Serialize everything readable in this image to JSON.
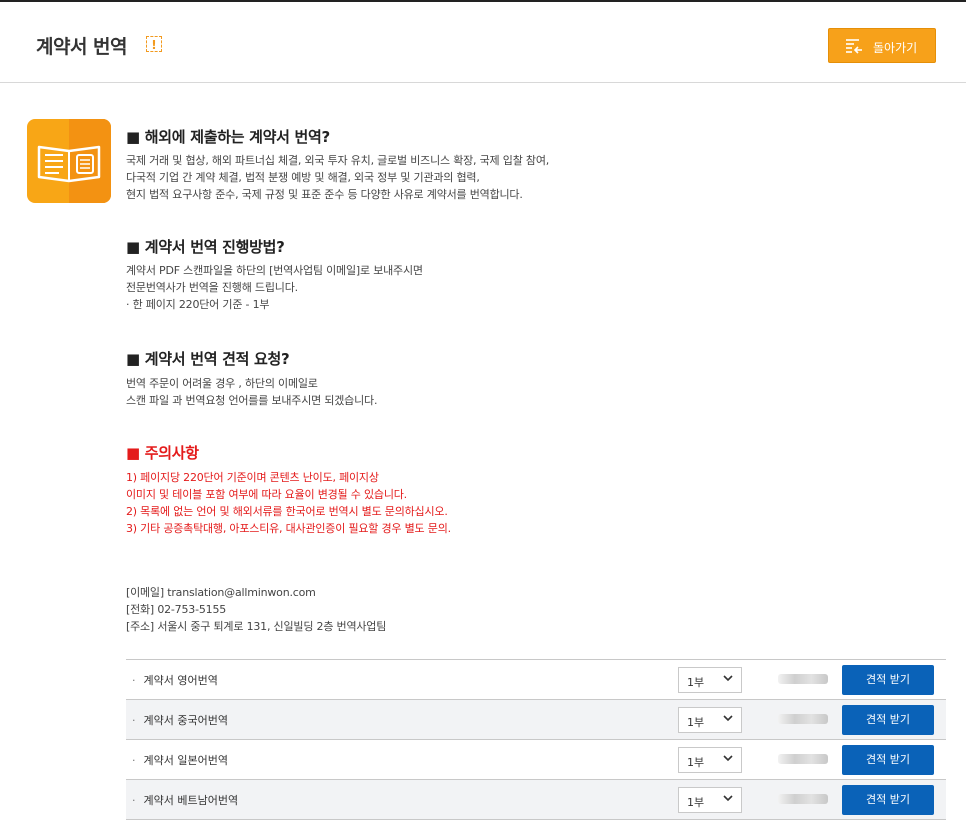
{
  "header": {
    "title": "계약서 번역",
    "info_badge": "!",
    "back_label": "돌아가기"
  },
  "sections": [
    {
      "title": "■ 해외에 제출하는 계약서 번역?",
      "lines": [
        "국제 거래 및 협상, 해외 파트너십 체결, 외국 투자 유치, 글로벌 비즈니스 확장, 국제 입찰 참여,",
        "다국적 기업 간 계약 체결, 법적 분쟁 예방 및 해결, 외국 정부 및 기관과의 협력,",
        "현지 법적 요구사항 준수, 국제 규정 및 표준 준수 등 다양한 사유로 계약서를 번역합니다."
      ]
    },
    {
      "title": "■ 계약서 번역 진행방법?",
      "lines": [
        "계약서 PDF 스캔파일을 하단의 [번역사업팀 이메일]로 보내주시면",
        "전문번역사가 번역을 진행해 드립니다.",
        "· 한 페이지 220단어 기준 - 1부"
      ]
    },
    {
      "title": "■ 계약서 번역 견적 요청?",
      "lines": [
        "번역 주문이 어려울 경우 , 하단의 이메일로",
        "스캔 파일 과 번역요청 언어를를 보내주시면 되겠습니다."
      ]
    }
  ],
  "notice": {
    "title": "■ 주의사항",
    "lines": [
      "1) 페이지당 220단어 기준이며 콘텐츠 난이도, 페이지상",
      "이미지 및 테이블 포함 여부에 따라 요율이 변경될 수 있습니다.",
      "2) 목록에 없는 언어 및 해외서류를 한국어로 번역시 별도 문의하십시오.",
      "3) 기타 공증촉탁대행, 아포스티유, 대사관인증이 필요할 경우 별도 문의."
    ]
  },
  "contact": {
    "email": "[이메일] translation@allminwon.com",
    "phone": "[전화] 02-753-5155",
    "address": "[주소] 서울시 중구 퇴계로 131, 신일빌딩 2층 번역사업팀"
  },
  "products": [
    {
      "name": "계약서 영어번역",
      "qty": "1부",
      "button": "견적 받기"
    },
    {
      "name": "계약서 중국어번역",
      "qty": "1부",
      "button": "견적 받기"
    },
    {
      "name": "계약서 일본어번역",
      "qty": "1부",
      "button": "견적 받기"
    },
    {
      "name": "계약서 베트남어번역",
      "qty": "1부",
      "button": "견적 받기"
    }
  ],
  "colors": {
    "accent_orange": "#f7a11a",
    "button_blue": "#0a62b8",
    "notice_red": "#e41b1b"
  }
}
